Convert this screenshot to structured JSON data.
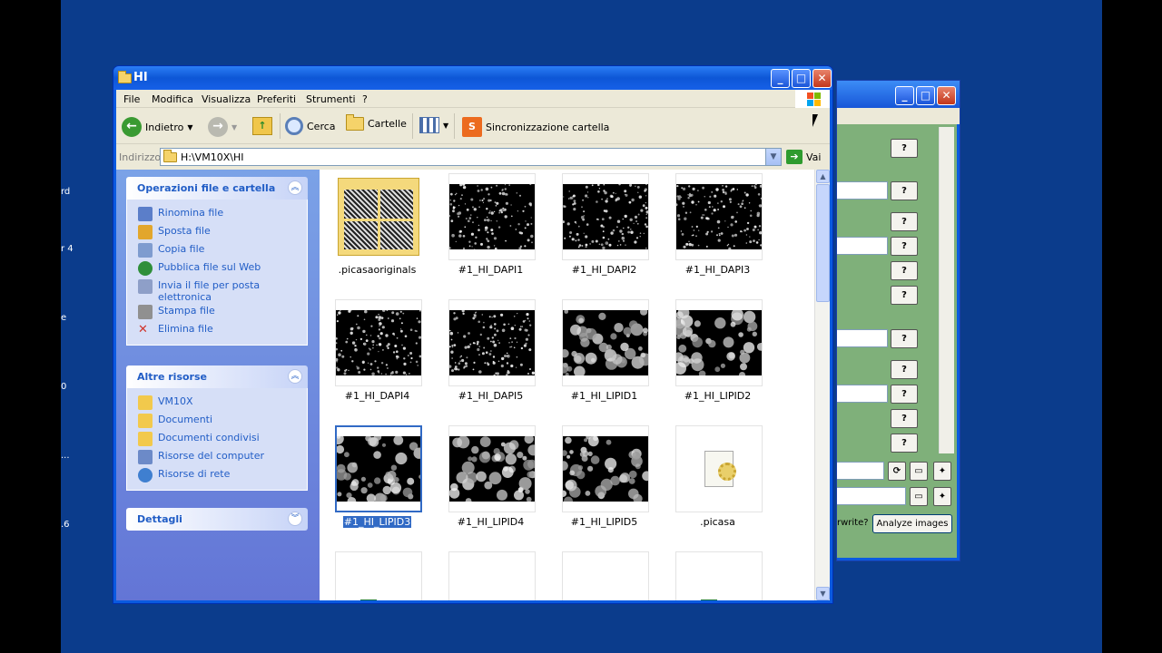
{
  "desktop": {
    "fragments": [
      "rd",
      "r 4",
      "e",
      "0",
      "...",
      ".6"
    ]
  },
  "background_window": {
    "help_button_label": "?",
    "analyze_button_label": "Analyze images",
    "overwrite_fragment": "rwrite?"
  },
  "window": {
    "title": "HI",
    "menu": [
      "File",
      "Modifica",
      "Visualizza",
      "Preferiti",
      "Strumenti",
      "?"
    ],
    "toolbar": {
      "back": "Indietro",
      "search": "Cerca",
      "folders": "Cartelle",
      "sync": "Sincronizzazione cartella"
    },
    "address": {
      "label": "Indirizzo",
      "path": "H:\\VM10X\\HI",
      "go": "Vai"
    },
    "task_pane": {
      "file_tasks": {
        "title": "Operazioni file e cartella",
        "items": [
          {
            "label": "Rinomina file",
            "icon": "rename-icon"
          },
          {
            "label": "Sposta file",
            "icon": "move-icon"
          },
          {
            "label": "Copia file",
            "icon": "copy-icon"
          },
          {
            "label": "Pubblica file sul Web",
            "icon": "globe-icon"
          },
          {
            "label": "Invia il file per posta elettronica",
            "icon": "mail-icon"
          },
          {
            "label": "Stampa file",
            "icon": "printer-icon"
          },
          {
            "label": "Elimina file",
            "icon": "delete-icon"
          }
        ]
      },
      "other_places": {
        "title": "Altre risorse",
        "items": [
          {
            "label": "VM10X",
            "icon": "folder-icon"
          },
          {
            "label": "Documenti",
            "icon": "folder-icon"
          },
          {
            "label": "Documenti condivisi",
            "icon": "folder-icon"
          },
          {
            "label": "Risorse del computer",
            "icon": "computer-icon"
          },
          {
            "label": "Risorse di rete",
            "icon": "network-icon"
          }
        ]
      },
      "details": {
        "title": "Dettagli"
      }
    },
    "files": [
      {
        "name": ".picasaoriginals",
        "kind": "folder"
      },
      {
        "name": "#1_HI_DAPI1",
        "kind": "dapi"
      },
      {
        "name": "#1_HI_DAPI2",
        "kind": "dapi"
      },
      {
        "name": "#1_HI_DAPI3",
        "kind": "dapi"
      },
      {
        "name": "#1_HI_DAPI4",
        "kind": "dapi"
      },
      {
        "name": "#1_HI_DAPI5",
        "kind": "dapi"
      },
      {
        "name": "#1_HI_LIPID1",
        "kind": "lipid"
      },
      {
        "name": "#1_HI_LIPID2",
        "kind": "lipid"
      },
      {
        "name": "#1_HI_LIPID3",
        "kind": "lipid",
        "selected": true
      },
      {
        "name": "#1_HI_LIPID4",
        "kind": "lipid"
      },
      {
        "name": "#1_HI_LIPID5",
        "kind": "lipid"
      },
      {
        "name": ".picasa",
        "kind": "ini"
      },
      {
        "name": "",
        "kind": "excel"
      },
      {
        "name": "",
        "kind": "table"
      },
      {
        "name": "",
        "kind": "table"
      },
      {
        "name": "",
        "kind": "excel"
      }
    ]
  }
}
